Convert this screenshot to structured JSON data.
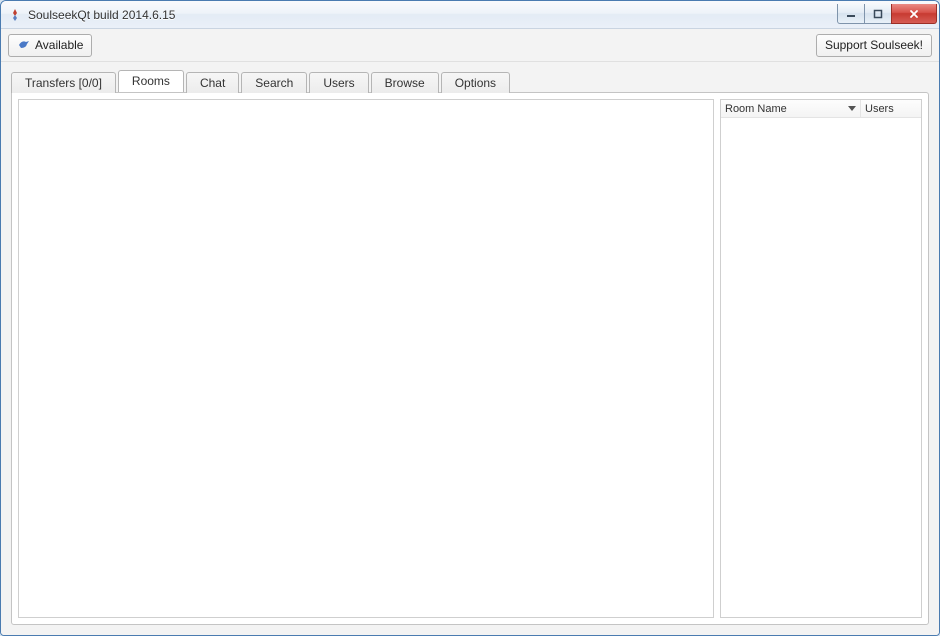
{
  "window": {
    "title": "SoulseekQt build 2014.6.15"
  },
  "toolbar": {
    "available_label": "Available",
    "support_label": "Support Soulseek!"
  },
  "tabs": [
    {
      "label": "Transfers [0/0]",
      "active": false
    },
    {
      "label": "Rooms",
      "active": true
    },
    {
      "label": "Chat",
      "active": false
    },
    {
      "label": "Search",
      "active": false
    },
    {
      "label": "Users",
      "active": false
    },
    {
      "label": "Browse",
      "active": false
    },
    {
      "label": "Options",
      "active": false
    }
  ],
  "room_list": {
    "columns": {
      "room_name": "Room Name",
      "users": "Users"
    },
    "rows": []
  }
}
